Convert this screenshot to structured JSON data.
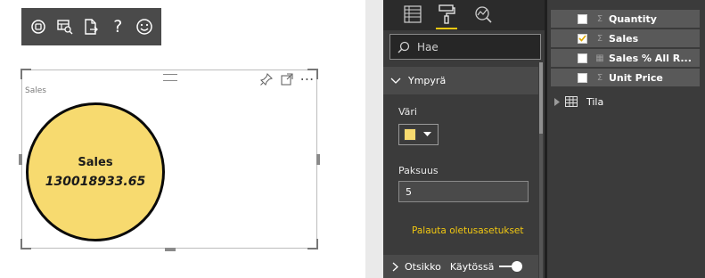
{
  "toolbar": {
    "icons": [
      "focus-mode-icon",
      "see-data-icon",
      "export-data-icon",
      "help-icon",
      "feedback-smile-icon"
    ],
    "help_glyph": "?"
  },
  "visual": {
    "title": "Sales",
    "icons": [
      "pin-icon",
      "focus-expand-icon",
      "more-options-icon"
    ],
    "more_glyph": "⋯",
    "card": {
      "label": "Sales",
      "value": "130018933.65",
      "fill_color": "#f7da6f",
      "border_color": "#0a0a0a"
    }
  },
  "format_pane": {
    "tabs": [
      "fields-tab",
      "format-tab",
      "analytics-tab"
    ],
    "active_tab": "format-tab",
    "search_placeholder": "Hae",
    "section": {
      "title": "Ympyrä",
      "color_label": "Väri",
      "color_value": "#f7da6f",
      "thickness_label": "Paksuus",
      "thickness_value": "5",
      "reset_label": "Palauta oletusasetukset"
    },
    "next_section": {
      "title": "Otsikko",
      "state": "Käytössä"
    },
    "accent_color": "#f2c811"
  },
  "fields_pane": {
    "fields": [
      {
        "name": "Quantity",
        "type_glyph": "Σ",
        "checked": false
      },
      {
        "name": "Sales",
        "type_glyph": "Σ",
        "checked": true
      },
      {
        "name": "Sales % All R...",
        "type_glyph": "▦",
        "checked": false
      },
      {
        "name": "Unit Price",
        "type_glyph": "Σ",
        "checked": false
      }
    ],
    "table": {
      "name": "Tila"
    }
  }
}
